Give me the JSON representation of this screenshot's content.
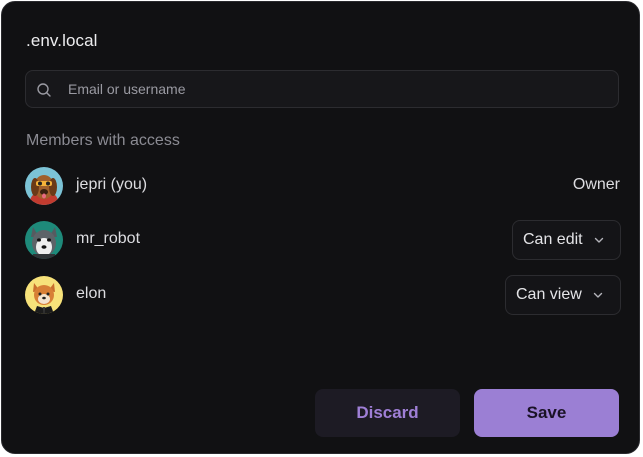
{
  "dialog": {
    "title": ".env.local"
  },
  "search": {
    "placeholder": "Email or username",
    "icon": "search-icon"
  },
  "members": {
    "section_label": "Members with access",
    "items": [
      {
        "name": "jepri (you)",
        "role": "Owner",
        "avatar": "dog-with-glasses-avatar",
        "editable": false
      },
      {
        "name": "mr_robot",
        "role": "Can edit",
        "avatar": "husky-avatar",
        "editable": true
      },
      {
        "name": "elon",
        "role": "Can view",
        "avatar": "shiba-avatar",
        "editable": true
      }
    ]
  },
  "actions": {
    "discard_label": "Discard",
    "save_label": "Save"
  },
  "colors": {
    "background": "#111113",
    "accent": "#9b7fd4",
    "accent_text": "#9f7fd6",
    "muted_text": "#8b8b93"
  }
}
